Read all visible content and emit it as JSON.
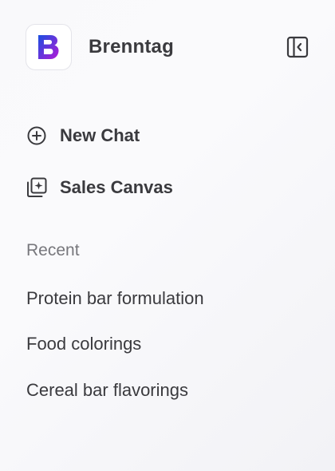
{
  "header": {
    "brand_name": "Brenntag",
    "logo_letter": "B"
  },
  "nav": {
    "new_chat": {
      "label": "New Chat",
      "icon": "plus-circle-icon"
    },
    "sales_canvas": {
      "label": "Sales Canvas",
      "icon": "sparkle-gallery-icon"
    }
  },
  "recent": {
    "title": "Recent",
    "items": [
      {
        "label": "Protein bar formulation"
      },
      {
        "label": "Food colorings"
      },
      {
        "label": "Cereal bar flavorings"
      }
    ]
  },
  "colors": {
    "logo_gradient_start": "#1a4fe0",
    "logo_gradient_end": "#b31ad6",
    "text_primary": "#3a3a3e",
    "text_muted": "#77777c"
  }
}
